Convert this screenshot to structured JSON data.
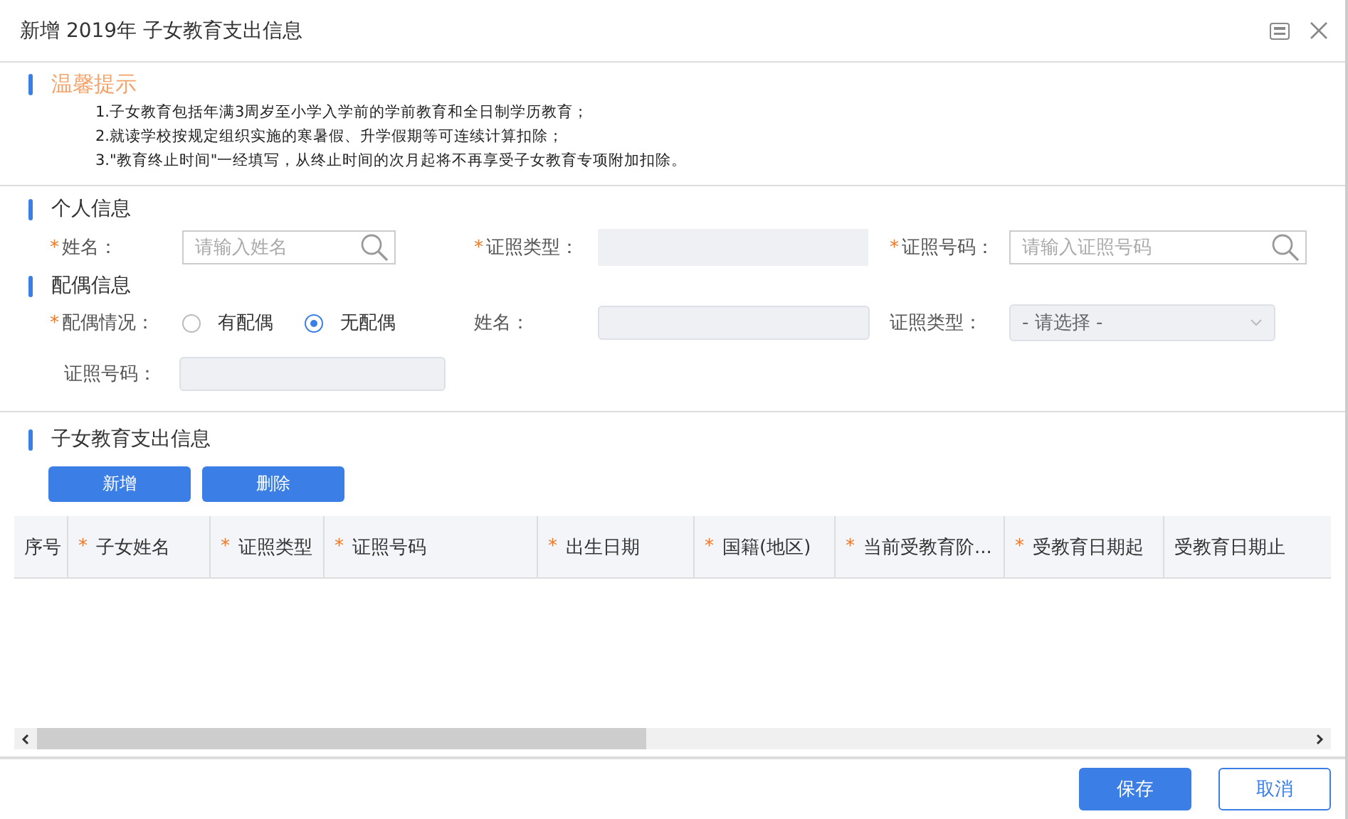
{
  "window": {
    "title": "新增 2019年 子女教育支出信息"
  },
  "tips": {
    "heading": "温馨提示",
    "lines": [
      "1.子女教育包括年满3周岁至小学入学前的学前教育和全日制学历教育；",
      "2.就读学校按规定组织实施的寒暑假、升学假期等可连续计算扣除；",
      "3.\"教育终止时间\"一经填写，从终止时间的次月起将不再享受子女教育专项附加扣除。"
    ]
  },
  "personal": {
    "heading": "个人信息",
    "fields": [
      {
        "label": "姓名：",
        "mark": "*",
        "kind": "search",
        "placeholder": "请输入姓名"
      },
      {
        "label": "证照类型：",
        "mark": "*",
        "kind": "readonly"
      },
      {
        "label": "证照号码：",
        "mark": "*",
        "kind": "search",
        "placeholder": "请输入证照号码"
      }
    ]
  },
  "spouse": {
    "heading": "配偶信息",
    "status": {
      "label": "配偶情况：",
      "mark": "*",
      "options": [
        {
          "label": "有配偶",
          "selected": false
        },
        {
          "label": "无配偶",
          "selected": true
        }
      ]
    },
    "fields": [
      {
        "label": "姓名：",
        "kind": "readonly"
      },
      {
        "label": "证照类型：",
        "kind": "select",
        "placeholder": "- 请选择 -"
      },
      {
        "label": "证照号码：",
        "kind": "readonly"
      }
    ]
  },
  "children": {
    "heading": "子女教育支出信息",
    "buttons": [
      "新增",
      "删除"
    ],
    "columns": [
      {
        "label": "序号"
      },
      {
        "label": "子女姓名",
        "mark": "*"
      },
      {
        "label": "证照类型",
        "mark": "*"
      },
      {
        "label": "证照号码",
        "mark": "*"
      },
      {
        "label": "出生日期",
        "mark": "*"
      },
      {
        "label": "国籍(地区)",
        "mark": "*"
      },
      {
        "label": "当前受教育阶...",
        "mark": "*"
      },
      {
        "label": "受教育日期起",
        "mark": "*"
      },
      {
        "label": "受教育日期止"
      }
    ]
  },
  "footer": {
    "buttons": [
      {
        "label": "保存",
        "kind": "primary"
      },
      {
        "label": "取消",
        "kind": "secondary"
      }
    ]
  }
}
